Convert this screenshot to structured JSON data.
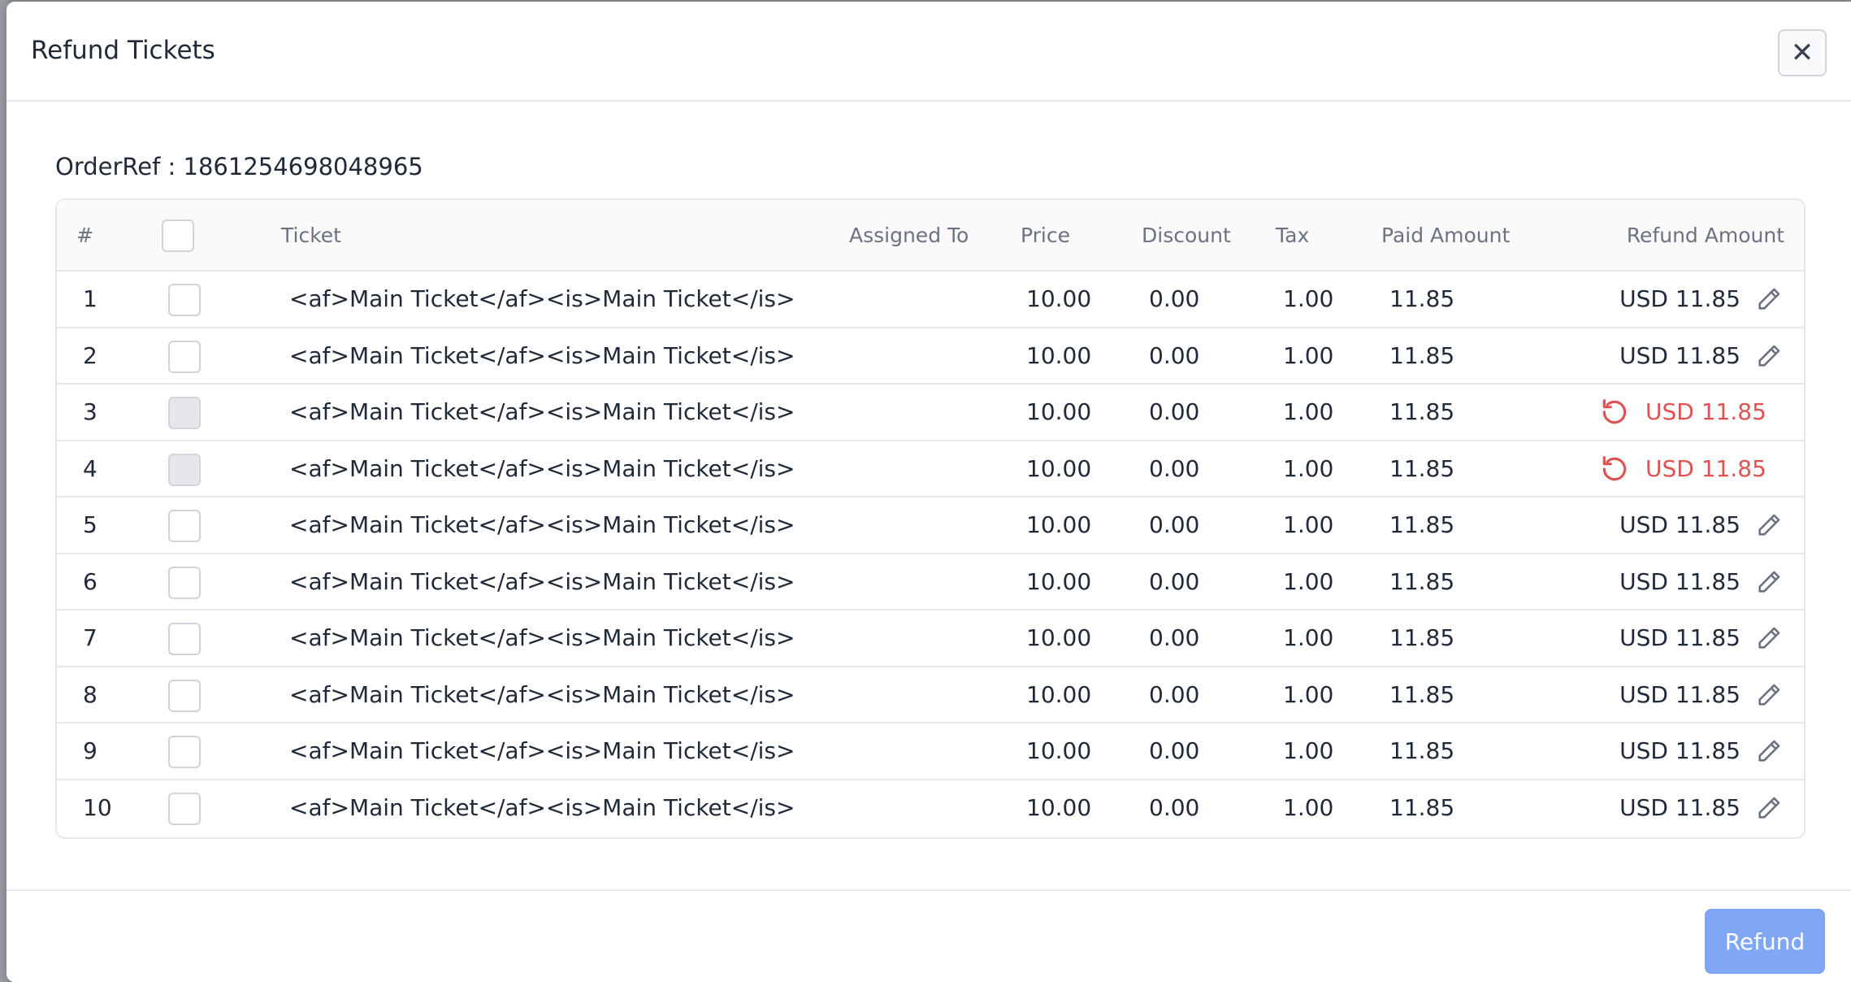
{
  "modal": {
    "title": "Refund Tickets",
    "close_symbol": "✕",
    "order_ref": "OrderRef : 1861254698048965",
    "refund_button": "Refund"
  },
  "table": {
    "headers": {
      "index": "#",
      "ticket": "Ticket",
      "assigned_to": "Assigned To",
      "price": "Price",
      "discount": "Discount",
      "tax": "Tax",
      "paid_amount": "Paid Amount",
      "refund_amount": "Refund Amount"
    },
    "rows": [
      {
        "num": "1",
        "ticket": "<af>Main Ticket</af><is>Main Ticket</is>",
        "assigned_to": "",
        "price": "10.00",
        "discount": "0.00",
        "tax": "1.00",
        "paid": "11.85",
        "refund": "USD 11.85",
        "refunded": false
      },
      {
        "num": "2",
        "ticket": "<af>Main Ticket</af><is>Main Ticket</is>",
        "assigned_to": "",
        "price": "10.00",
        "discount": "0.00",
        "tax": "1.00",
        "paid": "11.85",
        "refund": "USD 11.85",
        "refunded": false
      },
      {
        "num": "3",
        "ticket": "<af>Main Ticket</af><is>Main Ticket</is>",
        "assigned_to": "",
        "price": "10.00",
        "discount": "0.00",
        "tax": "1.00",
        "paid": "11.85",
        "refund": "USD 11.85",
        "refunded": true
      },
      {
        "num": "4",
        "ticket": "<af>Main Ticket</af><is>Main Ticket</is>",
        "assigned_to": "",
        "price": "10.00",
        "discount": "0.00",
        "tax": "1.00",
        "paid": "11.85",
        "refund": "USD 11.85",
        "refunded": true
      },
      {
        "num": "5",
        "ticket": "<af>Main Ticket</af><is>Main Ticket</is>",
        "assigned_to": "",
        "price": "10.00",
        "discount": "0.00",
        "tax": "1.00",
        "paid": "11.85",
        "refund": "USD 11.85",
        "refunded": false
      },
      {
        "num": "6",
        "ticket": "<af>Main Ticket</af><is>Main Ticket</is>",
        "assigned_to": "",
        "price": "10.00",
        "discount": "0.00",
        "tax": "1.00",
        "paid": "11.85",
        "refund": "USD 11.85",
        "refunded": false
      },
      {
        "num": "7",
        "ticket": "<af>Main Ticket</af><is>Main Ticket</is>",
        "assigned_to": "",
        "price": "10.00",
        "discount": "0.00",
        "tax": "1.00",
        "paid": "11.85",
        "refund": "USD 11.85",
        "refunded": false
      },
      {
        "num": "8",
        "ticket": "<af>Main Ticket</af><is>Main Ticket</is>",
        "assigned_to": "",
        "price": "10.00",
        "discount": "0.00",
        "tax": "1.00",
        "paid": "11.85",
        "refund": "USD 11.85",
        "refunded": false
      },
      {
        "num": "9",
        "ticket": "<af>Main Ticket</af><is>Main Ticket</is>",
        "assigned_to": "",
        "price": "10.00",
        "discount": "0.00",
        "tax": "1.00",
        "paid": "11.85",
        "refund": "USD 11.85",
        "refunded": false
      },
      {
        "num": "10",
        "ticket": "<af>Main Ticket</af><is>Main Ticket</is>",
        "assigned_to": "",
        "price": "10.00",
        "discount": "0.00",
        "tax": "1.00",
        "paid": "11.85",
        "refund": "USD 11.85",
        "refunded": false
      }
    ]
  },
  "icons": {
    "edit": "pencil-icon",
    "refunded": "undo-icon",
    "close": "close-icon"
  },
  "colors": {
    "refunded_text": "#e05252",
    "primary_button": "#7fa7f5"
  }
}
